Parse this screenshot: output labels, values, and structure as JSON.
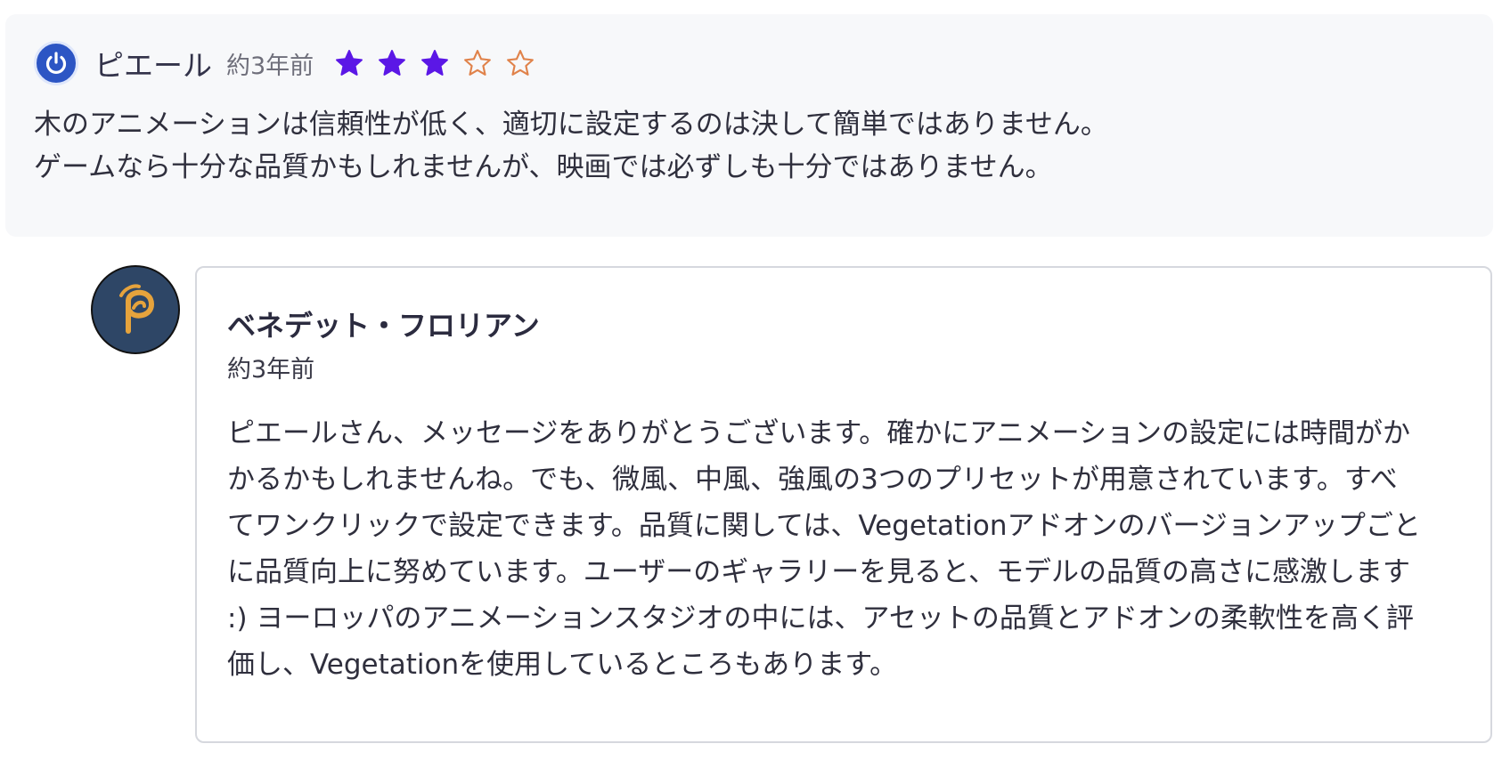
{
  "review": {
    "reviewer_name": "ピエール",
    "time_ago": "約3年前",
    "rating": 3,
    "rating_max": 5,
    "body_lines": [
      "木のアニメーションは信頼性が低く、適切に設定するのは決して簡単ではありません。",
      "ゲームなら十分な品質かもしれませんが、映画では必ずしも十分ではありません。"
    ]
  },
  "reply": {
    "author_name": "ベネデット・フロリアン",
    "time_ago": "約3年前",
    "body_lines": [
      "ピエールさん、メッセージをありがとうございます。確かにアニメーションの設定には時間がか",
      "かるかもしれませんね。でも、微風、中風、強風の3つのプリセットが用意されています。すべ",
      "てワンクリックで設定できます。品質に関しては、Vegetationアドオンのバージョンアップごと",
      "に品質向上に努めています。ユーザーのギャラリーを見ると、モデルの品質の高さに感激します",
      ":) ヨーロッパのアニメーションスタジオの中には、アセットの品質とアドオンの柔軟性を高く評",
      "価し、Vegetationを使用しているところもあります。"
    ]
  },
  "colors": {
    "star_filled": "#5b17e6",
    "star_empty_outline": "#e0824a",
    "review_bg": "#f7f8fa",
    "reviewer_avatar": "#2c55c4",
    "reply_avatar_bg": "#2e4666",
    "reply_logo": "#e6a33c"
  },
  "icons": {
    "reviewer_avatar": "power-icon",
    "reply_avatar": "leaf-p-logo-icon",
    "star": "star-icon"
  }
}
